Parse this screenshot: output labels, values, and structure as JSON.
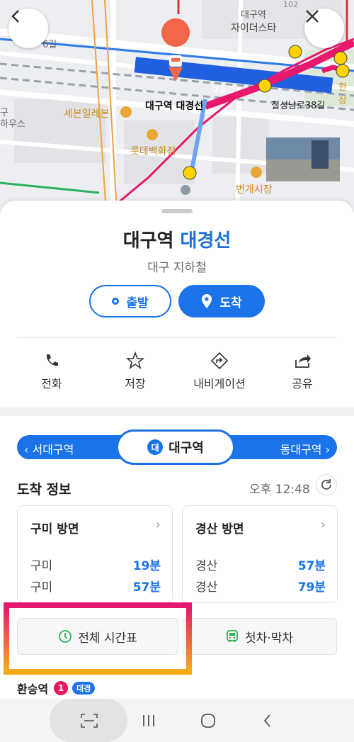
{
  "map": {
    "labels": {
      "station_top": "대구역",
      "xi": "자이더스타",
      "seven_eleven": "세븐일레븐",
      "lotte": "롯데백화점",
      "station_marker": "대구역 대경선",
      "line_label": "대경선",
      "street": "칠성남로38길",
      "market": "번개시장",
      "left_fragment1": "구",
      "left_fragment2": "하우스",
      "gil": "6길",
      "right_fragment": "한상",
      "num_102": "102"
    }
  },
  "nav": {
    "back_icon": "back-icon",
    "close_icon": "close-icon"
  },
  "station": {
    "name": "대구역",
    "line": "대경선",
    "operator": "대구 지하철",
    "depart_label": "출발",
    "arrive_label": "도착"
  },
  "actions": [
    {
      "label": "전화",
      "icon": "phone-icon"
    },
    {
      "label": "저장",
      "icon": "star-icon"
    },
    {
      "label": "내비게이션",
      "icon": "navigation-icon"
    },
    {
      "label": "공유",
      "icon": "share-icon"
    }
  ],
  "station_bar": {
    "prev": "서대구역",
    "current": "대구역",
    "current_badge": "대",
    "next": "동대구역"
  },
  "arrival": {
    "title": "도착 정보",
    "time": "오후 12:48",
    "cards": [
      {
        "direction": "구미 방면",
        "rows": [
          {
            "dest": "구미",
            "min": "19분"
          },
          {
            "dest": "구미",
            "min": "57분"
          }
        ]
      },
      {
        "direction": "경산 방면",
        "rows": [
          {
            "dest": "경산",
            "min": "57분"
          },
          {
            "dest": "경산",
            "min": "79분"
          }
        ]
      }
    ],
    "timetable_label": "전체 시간표",
    "first_last_label": "첫차·막차"
  },
  "transfer": {
    "label": "환승역",
    "count": "1",
    "tag": "대경"
  },
  "colors": {
    "accent": "#1a73e8",
    "line_magenta": "#e8186e",
    "marker": "#f2664a"
  }
}
